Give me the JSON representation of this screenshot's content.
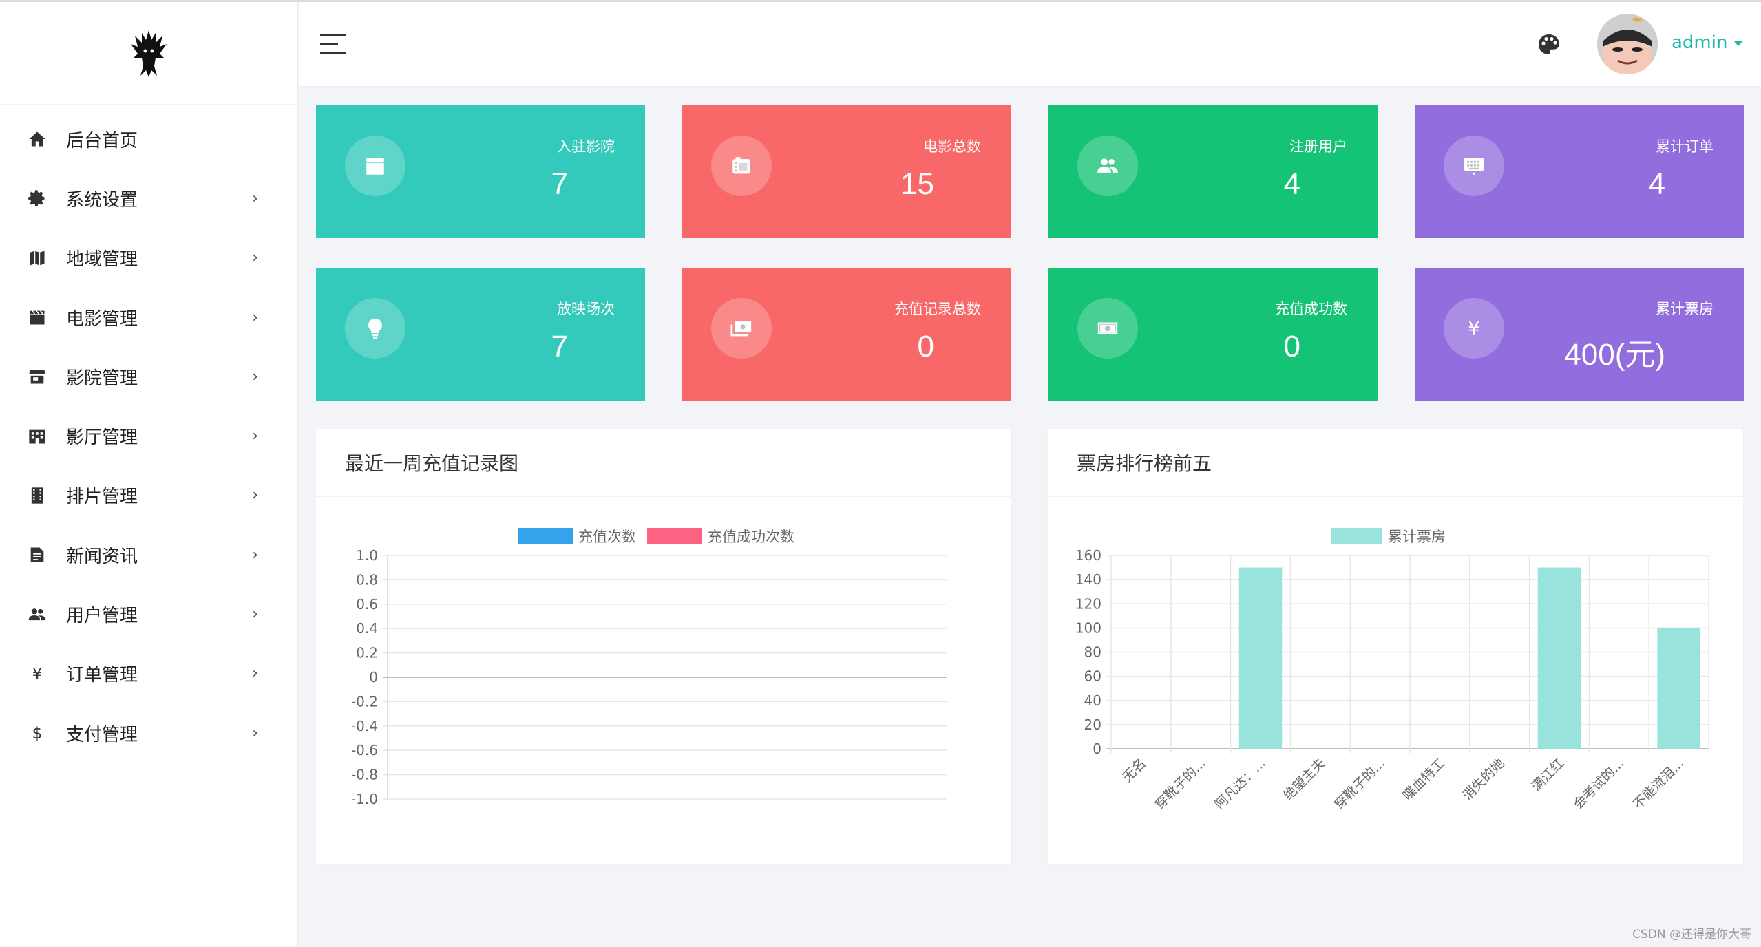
{
  "sidebar": {
    "items": [
      {
        "label": "后台首页",
        "icon": "home-icon",
        "has_arrow": false
      },
      {
        "label": "系统设置",
        "icon": "gear-icon",
        "has_arrow": true
      },
      {
        "label": "地域管理",
        "icon": "map-icon",
        "has_arrow": true
      },
      {
        "label": "电影管理",
        "icon": "clapperboard-icon",
        "has_arrow": true
      },
      {
        "label": "影院管理",
        "icon": "store-icon",
        "has_arrow": true
      },
      {
        "label": "影厅管理",
        "icon": "building-icon",
        "has_arrow": true
      },
      {
        "label": "排片管理",
        "icon": "film-strip-icon",
        "has_arrow": true
      },
      {
        "label": "新闻资讯",
        "icon": "document-icon",
        "has_arrow": true
      },
      {
        "label": "用户管理",
        "icon": "users-icon",
        "has_arrow": true
      },
      {
        "label": "订单管理",
        "icon": "yen-icon",
        "has_arrow": true
      },
      {
        "label": "支付管理",
        "icon": "dollar-icon",
        "has_arrow": true
      }
    ],
    "arrow": "›"
  },
  "header": {
    "user": "admin"
  },
  "cards": [
    {
      "title": "入驻影院",
      "value": "7",
      "color": "#33cabb",
      "icon": "clapperboard-icon"
    },
    {
      "title": "电影总数",
      "value": "15",
      "color": "#f96868",
      "icon": "film-roll-icon"
    },
    {
      "title": "注册用户",
      "value": "4",
      "color": "#15c377",
      "icon": "users-icon"
    },
    {
      "title": "累计订单",
      "value": "4",
      "color": "#926dde",
      "icon": "keyboard-icon"
    },
    {
      "title": "放映场次",
      "value": "7",
      "color": "#33cabb",
      "icon": "lightbulb-icon"
    },
    {
      "title": "充值记录总数",
      "value": "0",
      "color": "#f96868",
      "icon": "cash-stack-icon"
    },
    {
      "title": "充值成功数",
      "value": "0",
      "color": "#15c377",
      "icon": "banknote-icon"
    },
    {
      "title": "累计票房",
      "value": "400(元)",
      "color": "#926dde",
      "icon": "yen-icon"
    }
  ],
  "panels": {
    "recharge_title": "最近一周充值记录图",
    "boxoffice_title": "票房排行榜前五"
  },
  "chart_data": [
    {
      "type": "line",
      "title": "最近一周充值记录图",
      "series": [
        {
          "name": "充值次数",
          "color": "#36a2eb",
          "values": []
        },
        {
          "name": "充值成功次数",
          "color": "#ff6384",
          "values": []
        }
      ],
      "ylim": [
        -1.0,
        1.0
      ],
      "yticks": [
        "1.0",
        "0.8",
        "0.6",
        "0.4",
        "0.2",
        "0",
        "-0.2",
        "-0.4",
        "-0.6",
        "-0.8",
        "-1.0"
      ],
      "grid": true,
      "legend": "top"
    },
    {
      "type": "bar",
      "title": "票房排行榜前五",
      "categories": [
        "无名",
        "穿靴子的...",
        "阿凡达：...",
        "绝望主夫",
        "穿靴子的...",
        "喋血特工",
        "消失的她",
        "满江红",
        "会考试的...",
        "不能流泪..."
      ],
      "series": [
        {
          "name": "累计票房",
          "color": "#98e3dc",
          "values": [
            0,
            0,
            150,
            0,
            0,
            0,
            0,
            150,
            0,
            100
          ]
        }
      ],
      "ylim": [
        0,
        160
      ],
      "yticks": [
        "160",
        "140",
        "120",
        "100",
        "80",
        "60",
        "40",
        "20",
        "0"
      ],
      "grid": true,
      "legend": "top"
    }
  ],
  "watermark": "CSDN @还得是你大哥"
}
